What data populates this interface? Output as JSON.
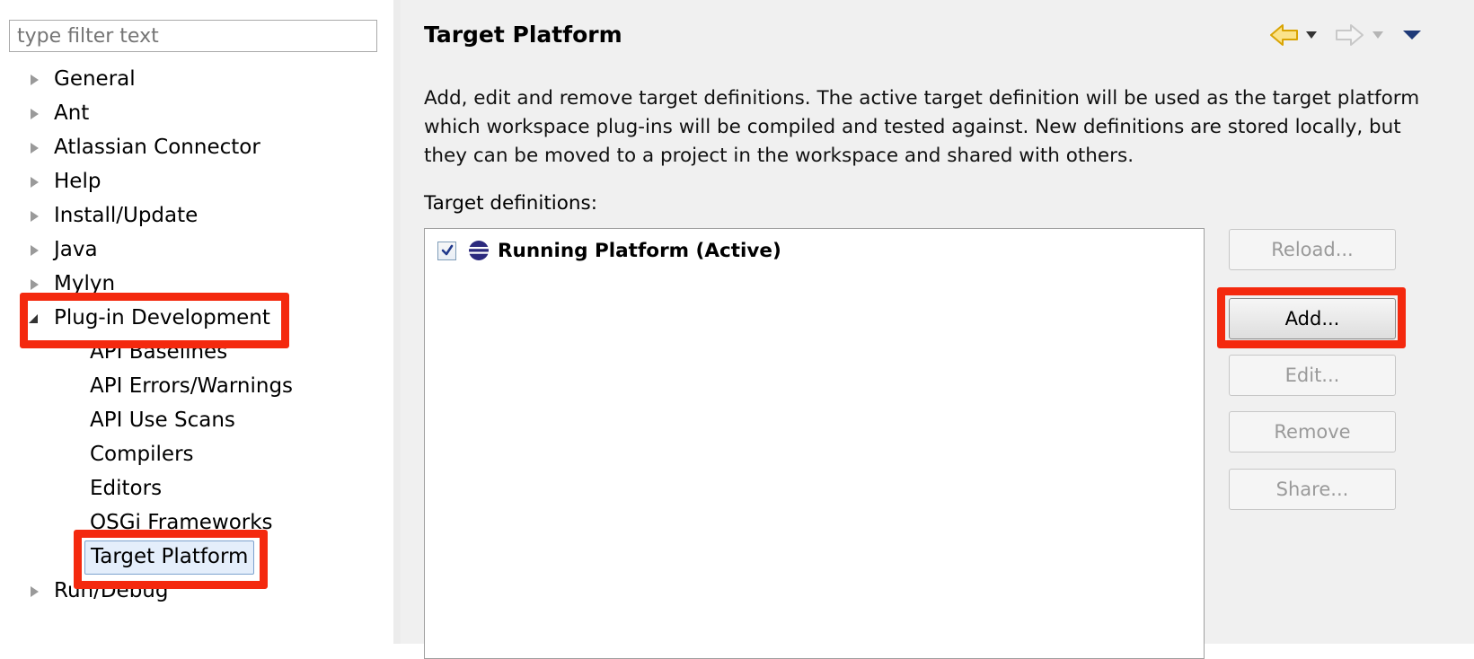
{
  "filter": {
    "placeholder": "type filter text"
  },
  "tree": {
    "items": [
      {
        "label": "General",
        "expanded": false
      },
      {
        "label": "Ant",
        "expanded": false
      },
      {
        "label": "Atlassian Connector",
        "expanded": false
      },
      {
        "label": "Help",
        "expanded": false
      },
      {
        "label": "Install/Update",
        "expanded": false
      },
      {
        "label": "Java",
        "expanded": false
      },
      {
        "label": "Mylyn",
        "expanded": false
      },
      {
        "label": "Plug-in Development",
        "expanded": true
      },
      {
        "label": "API Baselines"
      },
      {
        "label": "API Errors/Warnings"
      },
      {
        "label": "API Use Scans"
      },
      {
        "label": "Compilers"
      },
      {
        "label": "Editors"
      },
      {
        "label": "OSGi Frameworks"
      },
      {
        "label": "Target Platform",
        "selected": true
      },
      {
        "label": "Run/Debug",
        "expanded": false
      }
    ]
  },
  "page": {
    "title": "Target Platform",
    "description": "Add, edit and remove target definitions.  The active target definition will be used as the target platform which workspace plug-ins will be compiled and tested against.  New definitions are stored locally, but they can be moved to a project in the workspace and shared with others.",
    "definitions_label": "Target definitions:",
    "definitions": [
      {
        "name": "Running Platform (Active)",
        "checked": true
      }
    ]
  },
  "buttons": {
    "reload": "Reload...",
    "add": "Add...",
    "edit": "Edit...",
    "remove": "Remove",
    "share": "Share..."
  },
  "nav": {
    "back_icon": "back-arrow-icon",
    "forward_icon": "forward-arrow-icon",
    "menu_icon": "view-menu-icon"
  },
  "colors": {
    "highlight": "#f4290e",
    "selection": "#e4eefb",
    "back_arrow": "#f2b705"
  }
}
